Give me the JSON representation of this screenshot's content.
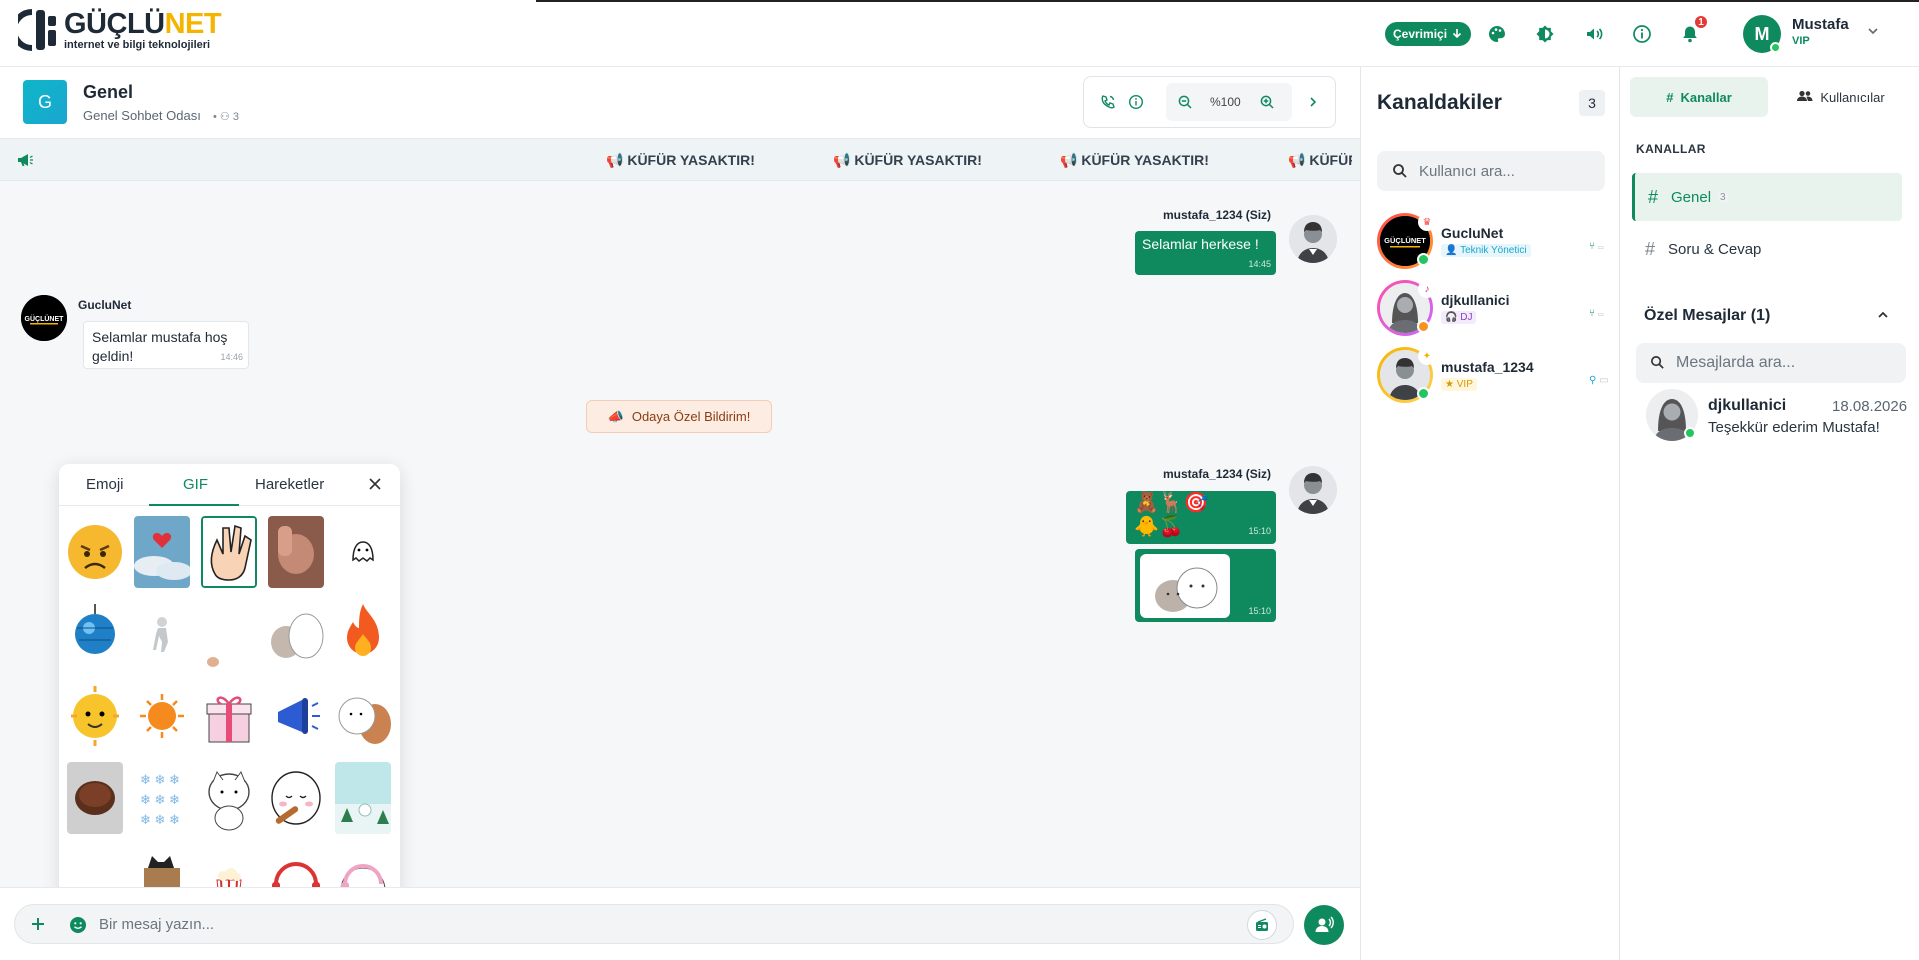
{
  "colors": {
    "accent": "#0f8a5f",
    "brand_yellow": "#f4b400",
    "notif": "#e53935"
  },
  "topbar": {
    "logo_main_a": "GÜÇLÜ",
    "logo_main_b": "NET",
    "logo_tagline": "internet ve bilgi teknolojileri",
    "status_label": "Çevrimiçi",
    "notif_count": "1",
    "user_initial": "M",
    "user_name": "Mustafa",
    "user_role": "VIP",
    "icons": [
      "palette-icon",
      "contrast-icon",
      "volume-icon",
      "info-icon",
      "bell-icon"
    ]
  },
  "chat": {
    "room_initial": "G",
    "room_title": "Genel",
    "room_subtitle": "Genel Sohbet Odası",
    "room_users": "3",
    "zoom": "%100",
    "ticker_items": [
      "KÜFÜR YASAKTIR!",
      "KÜFÜR YASAKTIR!",
      "KÜFÜR YASAKTIR!",
      "KÜFÜR YASAKTIR!"
    ],
    "messages": [
      {
        "author": "mustafa_1234 (Siz)",
        "text": "Selamlar herkese !",
        "time": "14:45"
      },
      {
        "author": "GucluNet",
        "text": "Selamlar mustafa hoş geldin!",
        "time": "14:46"
      },
      {
        "author": "mustafa_1234 (Siz)",
        "text": "",
        "time": "15:10"
      },
      {
        "author": "",
        "text": "",
        "time": "15:10"
      }
    ],
    "system_notice": "Odaya Özel Bildirim!",
    "composer_placeholder": "Bir mesaj yazın..."
  },
  "gif_panel": {
    "tabs": [
      "Emoji",
      "GIF",
      "Hareketler"
    ],
    "active_tab": "GIF"
  },
  "members": {
    "title": "Kanaldakiler",
    "count": "3",
    "search_placeholder": "Kullanıcı ara...",
    "list": [
      {
        "name": "GucluNet",
        "role": "Teknik Yönetici",
        "status": "online"
      },
      {
        "name": "djkullanici",
        "role": "DJ",
        "status": "away"
      },
      {
        "name": "mustafa_1234",
        "role": "VIP",
        "status": "online"
      }
    ]
  },
  "sidebar": {
    "tab_channels": "Kanallar",
    "tab_users": "Kullanıcılar",
    "section_label": "KANALLAR",
    "channels": [
      {
        "name": "Genel",
        "count": "3"
      },
      {
        "name": "Soru & Cevap",
        "count": ""
      }
    ],
    "dm_header": "Özel Mesajlar (1)",
    "dm_search_placeholder": "Mesajlarda ara...",
    "dms": [
      {
        "name": "djkullanici",
        "date": "18.08.2026",
        "preview": "Teşekkür ederim Mustafa!"
      }
    ]
  }
}
